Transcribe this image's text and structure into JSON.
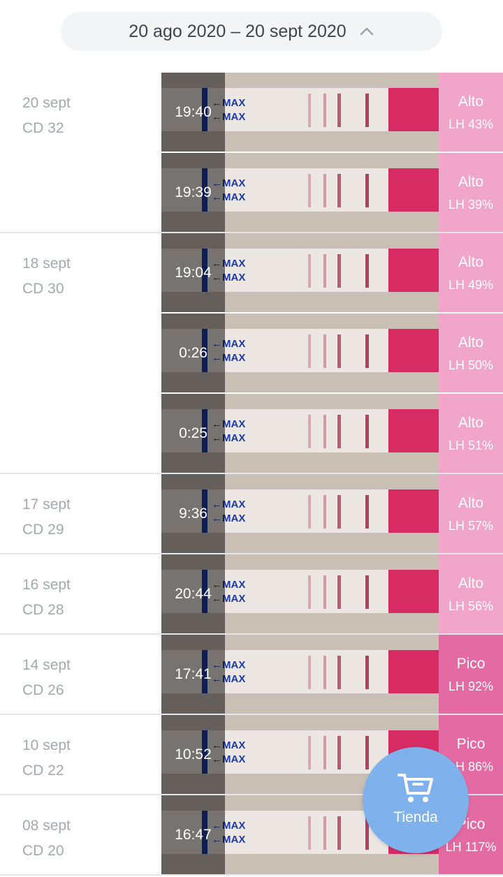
{
  "header": {
    "date_range": "20 ago 2020 – 20 sept 2020"
  },
  "colors": {
    "alto": "#f1a6c9",
    "pico": "#e46aa4",
    "fab": "#7fb2ec"
  },
  "groups": [
    {
      "date": "20 sept",
      "cd": "CD 32",
      "entries": [
        {
          "time": "19:40",
          "level": "Alto",
          "lh": "LH 43%"
        },
        {
          "time": "19:39",
          "level": "Alto",
          "lh": "LH 39%"
        }
      ]
    },
    {
      "date": "18 sept",
      "cd": "CD 30",
      "entries": [
        {
          "time": "19:04",
          "level": "Alto",
          "lh": "LH 49%"
        },
        {
          "time": "0:26",
          "level": "Alto",
          "lh": "LH 50%"
        },
        {
          "time": "0:25",
          "level": "Alto",
          "lh": "LH 51%"
        }
      ]
    },
    {
      "date": "17 sept",
      "cd": "CD 29",
      "entries": [
        {
          "time": "9:36",
          "level": "Alto",
          "lh": "LH 57%"
        }
      ]
    },
    {
      "date": "16 sept",
      "cd": "CD 28",
      "entries": [
        {
          "time": "20:44",
          "level": "Alto",
          "lh": "LH 56%"
        }
      ]
    },
    {
      "date": "14 sept",
      "cd": "CD 26",
      "entries": [
        {
          "time": "17:41",
          "level": "Pico",
          "lh": "LH 92%"
        }
      ]
    },
    {
      "date": "10 sept",
      "cd": "CD 22",
      "entries": [
        {
          "time": "10:52",
          "level": "Pico",
          "lh": "LH 86%"
        }
      ]
    },
    {
      "date": "08 sept",
      "cd": "CD 20",
      "entries": [
        {
          "time": "16:47",
          "level": "Pico",
          "lh": "LH 117%"
        }
      ]
    }
  ],
  "fab": {
    "label": "Tienda",
    "icon": "shopping-cart-icon"
  }
}
